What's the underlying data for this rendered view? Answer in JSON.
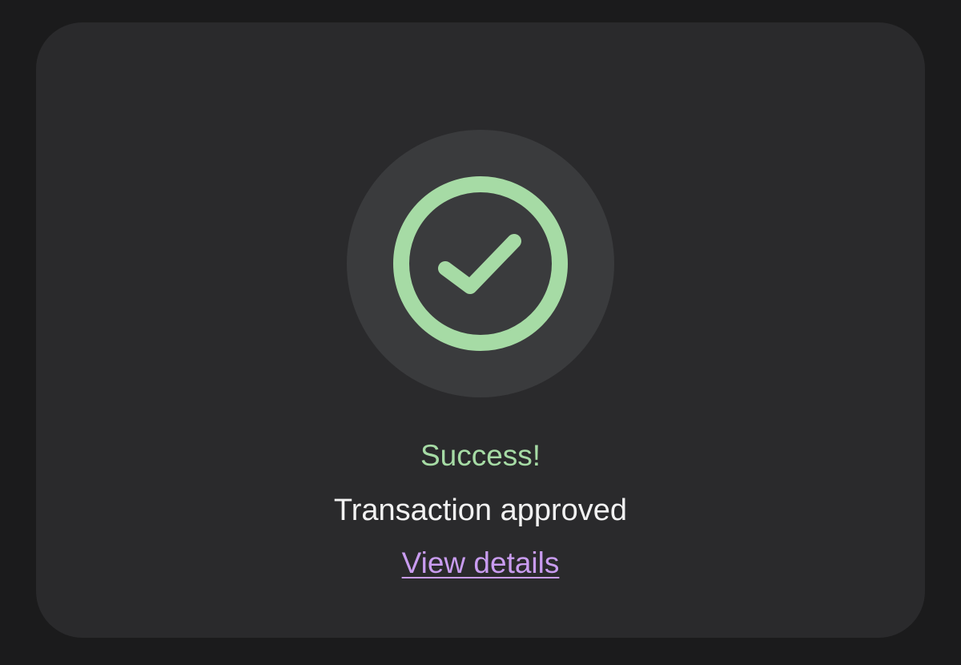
{
  "card": {
    "icon": "checkmark-circle-icon",
    "title": "Success!",
    "subtitle": "Transaction approved",
    "link_label": "View details"
  },
  "colors": {
    "page_background": "#1b1b1c",
    "card_background": "#2a2a2c",
    "icon_backdrop": "#3a3b3d",
    "success_accent": "#a6dba5",
    "primary_text": "#f2f2f2",
    "link": "#c99cf0"
  }
}
